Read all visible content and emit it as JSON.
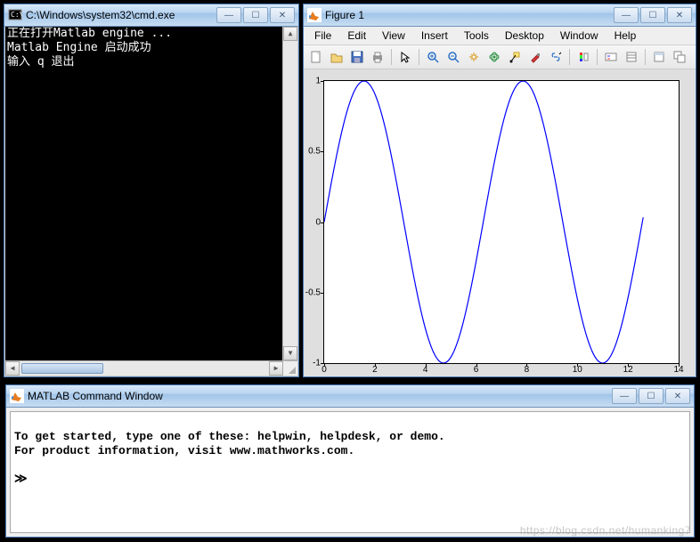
{
  "cmd": {
    "title": "C:\\Windows\\system32\\cmd.exe",
    "lines": [
      "正在打开Matlab engine ...",
      "Matlab Engine 启动成功",
      "输入 q 退出"
    ]
  },
  "figure": {
    "title": "Figure 1",
    "menus": [
      "File",
      "Edit",
      "View",
      "Insert",
      "Tools",
      "Desktop",
      "Window",
      "Help"
    ],
    "toolbar_icons": [
      "new-icon",
      "open-icon",
      "save-icon",
      "print-icon",
      "sep",
      "pointer-icon",
      "sep",
      "zoom-in-icon",
      "zoom-out-icon",
      "pan-icon",
      "rotate3d-icon",
      "datacursor-icon",
      "brush-icon",
      "link-icon",
      "sep",
      "colorbar-icon",
      "sep",
      "legend-icon",
      "insert-icon",
      "sep",
      "hide-tools-icon",
      "dock-icon"
    ]
  },
  "chart_data": {
    "type": "line",
    "xlabel": "",
    "ylabel": "",
    "xlim": [
      0,
      14
    ],
    "ylim": [
      -1,
      1
    ],
    "xticks": [
      0,
      2,
      4,
      6,
      8,
      10,
      12,
      14
    ],
    "yticks": [
      -1,
      -0.5,
      0,
      0.5,
      1
    ],
    "series": [
      {
        "name": "sin",
        "formula": "sin(x)",
        "x_range": [
          0,
          12.6
        ],
        "n_points": 200,
        "color": "#0000ff"
      }
    ]
  },
  "matlab_cmd": {
    "title": "MATLAB Command Window",
    "lines": [
      "To get started, type one of these: helpwin, helpdesk, or demo.",
      "For product information, visit www.mathworks.com."
    ],
    "prompt": "≫"
  },
  "window_buttons": {
    "min": "—",
    "max": "☐",
    "close": "✕"
  },
  "watermark": "https://blog.csdn.net/humanking7"
}
